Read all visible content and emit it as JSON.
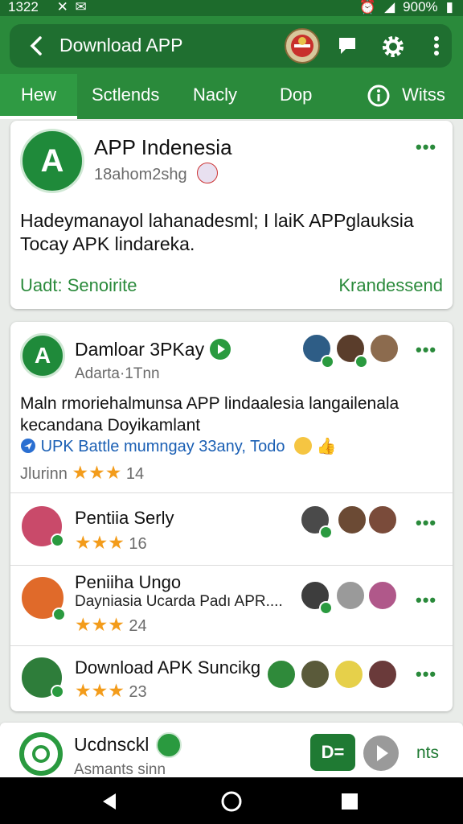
{
  "status_bar": {
    "time": "1322",
    "battery": "900%"
  },
  "app_bar": {
    "title": "Download APP"
  },
  "tabs": [
    {
      "label": "Hew"
    },
    {
      "label": "Sctlends"
    },
    {
      "label": "Nacly"
    },
    {
      "label": "Dop"
    },
    {
      "label": "Witss"
    }
  ],
  "featured": {
    "name": "APP Indenesia",
    "subtitle": "18ahom2shg",
    "description": "Hadeymanayol lahanadesml; I laiK APPglauksia Tocay APK lindareka.",
    "footer_left": "Uadt: Senoirite",
    "footer_right": "Krandessend"
  },
  "post": {
    "name": "Damloar 3PKay",
    "meta": "Adarta·1Tnn",
    "body": "Maln rmoriehalmunsa APP lindaalesia langailenala kecandana Doyikamlant",
    "link": "UPK Battle mumngay 33any, Todo",
    "rating_label": "Jlurinn",
    "rating_count": "14"
  },
  "list": [
    {
      "name": "Pentiia Serly",
      "subtitle": "",
      "count": "16"
    },
    {
      "name": "Peniiha Ungo",
      "subtitle": "Dayniasia Ucarda Padı APR....",
      "count": "24"
    },
    {
      "name": "Download APK Suncikg",
      "subtitle": "",
      "count": "23"
    }
  ],
  "bottom_card": {
    "name": "Ucdnsckl",
    "subtitle": "Asmants sinn",
    "button_label": "D=",
    "side_label": "nts"
  }
}
